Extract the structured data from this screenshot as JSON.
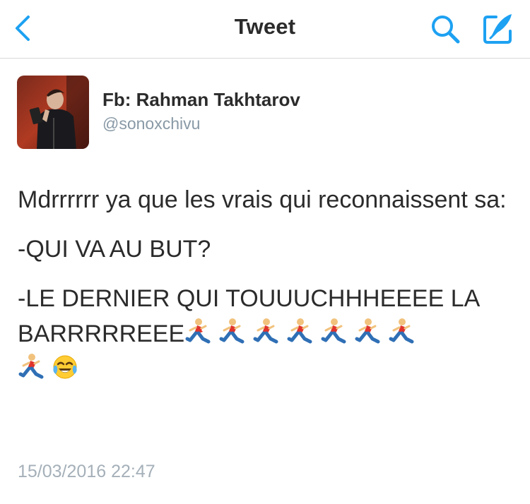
{
  "navbar": {
    "title": "Tweet",
    "back_icon": "chevron-left-icon",
    "search_icon": "search-icon",
    "compose_icon": "compose-icon",
    "accent_color": "#1da1f2"
  },
  "tweet": {
    "author": {
      "display_name": "Fb: Rahman Takhtarov",
      "handle": "@sonoxchivu"
    },
    "text_lines": [
      "Mdrrrrrr ya que les vrais qui reconnaissent sa:",
      "-QUI VA AU BUT?",
      "-LE DERNIER QUI TOUUUCHHHEEEE LA BARRRRREEE"
    ],
    "emojis": [
      "runner",
      "runner",
      "runner",
      "runner",
      "runner",
      "runner",
      "runner",
      "runner",
      "face-with-tears-of-joy"
    ],
    "timestamp": "15/03/2016 22:47"
  }
}
